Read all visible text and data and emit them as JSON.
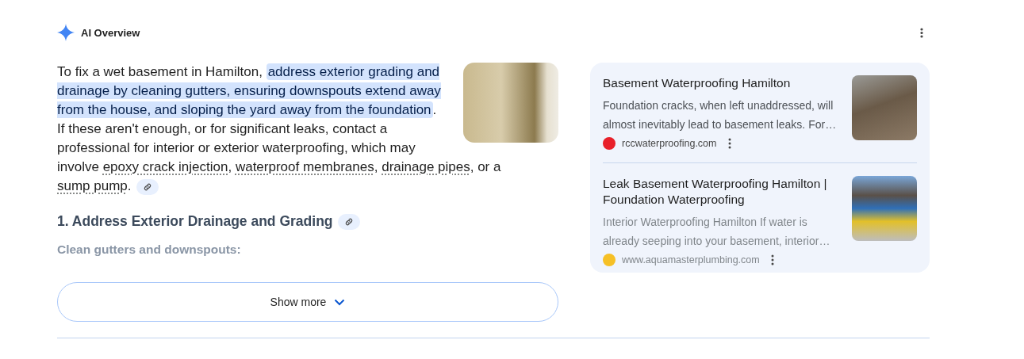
{
  "header": {
    "title": "AI Overview"
  },
  "summary": {
    "segments": [
      {
        "kind": "text",
        "text": "To fix a wet basement in Hamilton, "
      },
      {
        "kind": "highlight",
        "text": "address exterior grading and drainage by cleaning gutters, ensuring downspouts extend away from the house, and sloping the yard away from the foundation"
      },
      {
        "kind": "text",
        "text": ". If these aren't enough, or for significant leaks, contact a professional for interior or exterior waterproofing, which may involve "
      },
      {
        "kind": "term",
        "text": "epoxy crack injection"
      },
      {
        "kind": "text",
        "text": ", "
      },
      {
        "kind": "term",
        "text": "waterproof membranes"
      },
      {
        "kind": "text",
        "text": ", "
      },
      {
        "kind": "term",
        "text": "drainage pipes"
      },
      {
        "kind": "text",
        "text": ", or a "
      },
      {
        "kind": "term",
        "text": "sump pump"
      },
      {
        "kind": "text",
        "text": "."
      }
    ]
  },
  "section": {
    "heading": "1. Address Exterior Drainage and Grading",
    "subheading": "Clean gutters and downspouts:"
  },
  "show_more": {
    "label": "Show more"
  },
  "sources": [
    {
      "title": "Basement Waterproofing Hamilton",
      "snippet": "Foundation cracks, when left unaddressed, will almost inevitably lead to basement leaks. For…",
      "site": "rccwaterproofing.com",
      "color": "#e8202a"
    },
    {
      "title": "Leak Basement Waterproofing Hamilton | Foundation Waterproofing",
      "snippet": "Interior Waterproofing Hamilton If water is already seeping into your basement, interior…",
      "site": "www.aquamasterplumbing.com",
      "color": "#f6c026"
    }
  ]
}
